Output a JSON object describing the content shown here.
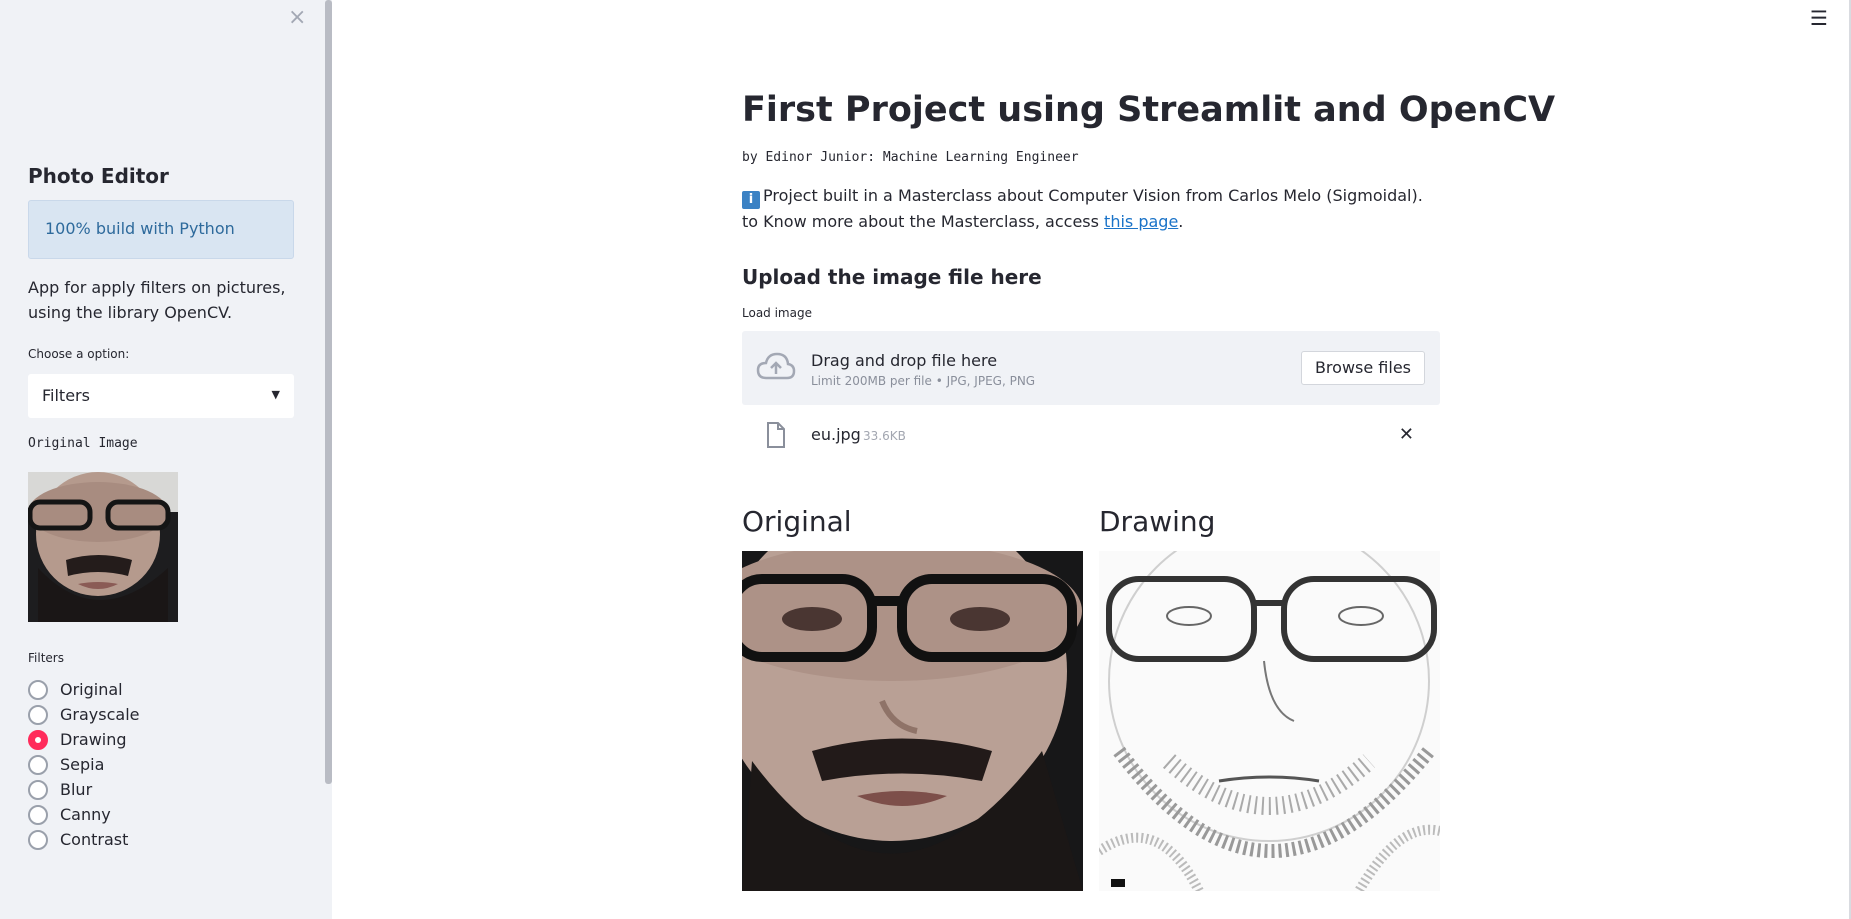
{
  "sidebar": {
    "close_icon": "×",
    "title": "Photo Editor",
    "info_text": "100% build with Python",
    "description": "App for apply filters on pictures, using the library OpenCV.",
    "choose_label": "Choose a option:",
    "select_value": "Filters",
    "original_image_label": "Original Image",
    "filters_label": "Filters",
    "filters": [
      {
        "label": "Original",
        "selected": false
      },
      {
        "label": "Grayscale",
        "selected": false
      },
      {
        "label": "Drawing",
        "selected": true
      },
      {
        "label": "Sepia",
        "selected": false
      },
      {
        "label": "Blur",
        "selected": false
      },
      {
        "label": "Canny",
        "selected": false
      },
      {
        "label": "Contrast",
        "selected": false
      }
    ]
  },
  "header": {
    "menu_icon": "☰"
  },
  "main": {
    "title": "First Project using Streamlit and OpenCV",
    "byline": "by Edinor Junior: Machine Learning Engineer",
    "intro_icon": "i",
    "intro_text": "Project built in a Masterclass about Computer Vision from Carlos Melo (Sigmoidal). to Know more about the Masterclass, access ",
    "intro_link": "this page",
    "intro_end": ".",
    "upload_heading": "Upload the image file here",
    "load_label": "Load image",
    "dropzone_main": "Drag and drop file here",
    "dropzone_sub": "Limit 200MB per file • JPG, JPEG, PNG",
    "browse_label": "Browse files",
    "file_name": "eu.jpg",
    "file_size": "33.6KB",
    "file_close": "✕",
    "col_original": "Original",
    "col_drawing": "Drawing"
  },
  "colors": {
    "accent": "#ff2b5b",
    "sidebar_bg": "#f0f2f6",
    "info_bg": "#d9e5f2",
    "link": "#1a73c8"
  }
}
